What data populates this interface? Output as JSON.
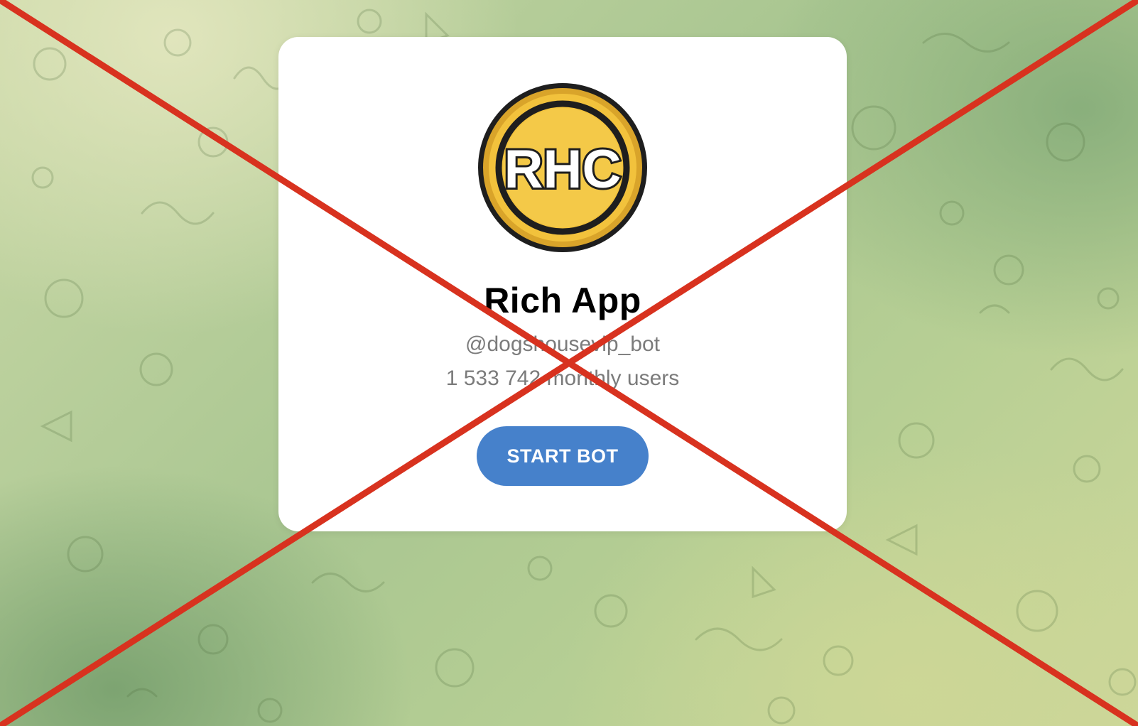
{
  "bot": {
    "title": "Rich App",
    "username": "@dogshousevip_bot",
    "monthly_users": "1 533 742 monthly users",
    "logo_text": "RHC"
  },
  "actions": {
    "start_label": "START BOT"
  },
  "colors": {
    "button": "#4681cb",
    "cross": "#d8321f",
    "logo_gold": "#f2c23c",
    "background": "#b4cc95"
  },
  "icons": {
    "logo": "rhc-coin-logo",
    "overlay": "red-x-cross-overlay"
  }
}
